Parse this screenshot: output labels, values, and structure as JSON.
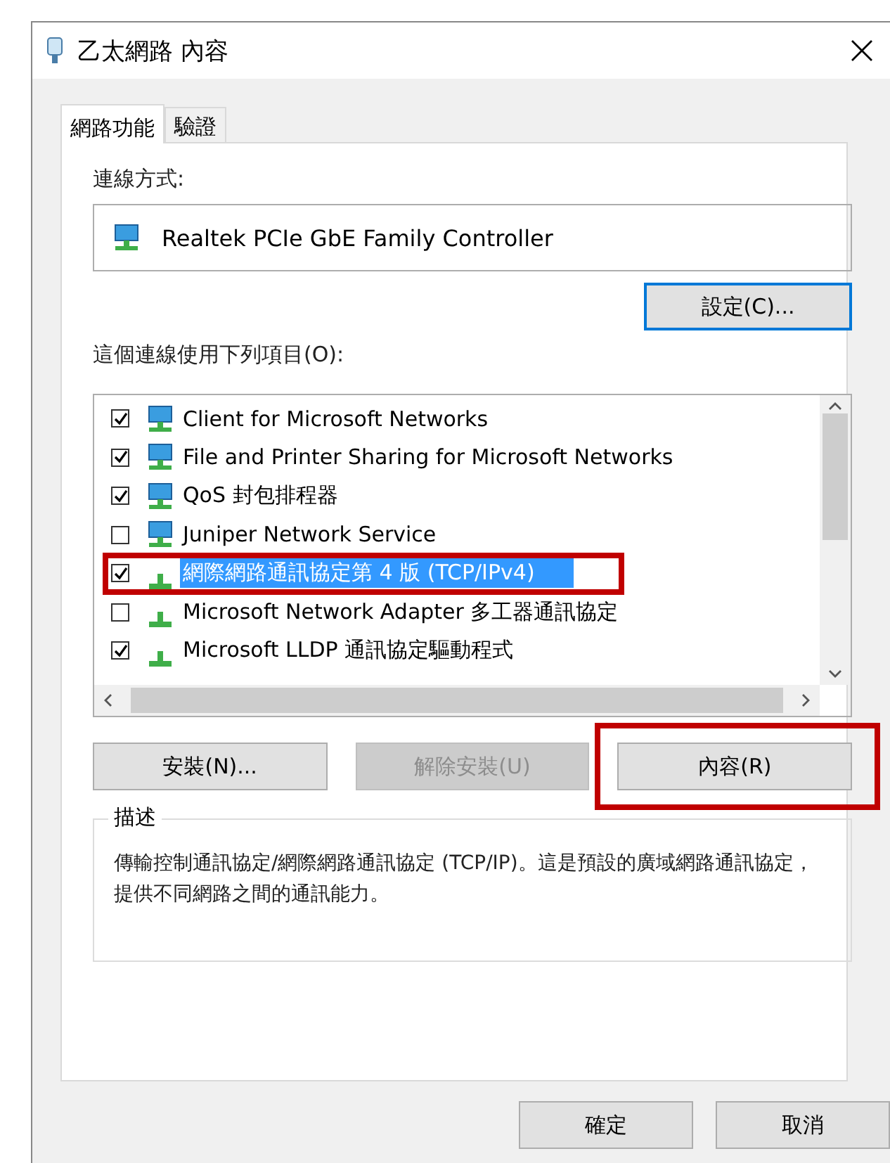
{
  "window": {
    "title": "乙太網路 內容"
  },
  "tabs": [
    {
      "label": "網路功能",
      "selected": true
    },
    {
      "label": "驗證",
      "selected": false
    }
  ],
  "connection": {
    "label": "連線方式:",
    "adapter": "Realtek PCIe GbE Family Controller",
    "configure_button": "設定(C)..."
  },
  "items": {
    "label": "這個連線使用下列項目(O):",
    "list": [
      {
        "label": "Client for Microsoft Networks",
        "kind": "computer",
        "checked": true,
        "selected": false,
        "highlighted": false
      },
      {
        "label": "File and Printer Sharing for Microsoft Networks",
        "kind": "computer",
        "checked": true,
        "selected": false,
        "highlighted": false
      },
      {
        "label": "QoS 封包排程器",
        "kind": "computer",
        "checked": true,
        "selected": false,
        "highlighted": false
      },
      {
        "label": "Juniper Network Service",
        "kind": "computer",
        "checked": false,
        "selected": false,
        "highlighted": false
      },
      {
        "label": "網際網路通訊協定第 4 版 (TCP/IPv4)",
        "kind": "protocol",
        "checked": true,
        "selected": true,
        "highlighted": true
      },
      {
        "label": "Microsoft Network Adapter 多工器通訊協定",
        "kind": "protocol",
        "checked": false,
        "selected": false,
        "highlighted": false
      },
      {
        "label": "Microsoft LLDP 通訊協定驅動程式",
        "kind": "protocol",
        "checked": true,
        "selected": false,
        "highlighted": false
      }
    ]
  },
  "buttons": [
    {
      "label": "安裝(N)...",
      "disabled": false,
      "highlighted": false
    },
    {
      "label": "解除安裝(U)",
      "disabled": true,
      "highlighted": false
    },
    {
      "label": "內容(R)",
      "disabled": false,
      "highlighted": true
    }
  ],
  "description": {
    "title": "描述",
    "text": "傳輸控制通訊協定/網際網路通訊協定 (TCP/IP)。這是預設的廣域網路通訊協定，提供不同網路之間的通訊能力。"
  },
  "footer_buttons": [
    "確定",
    "取消"
  ]
}
